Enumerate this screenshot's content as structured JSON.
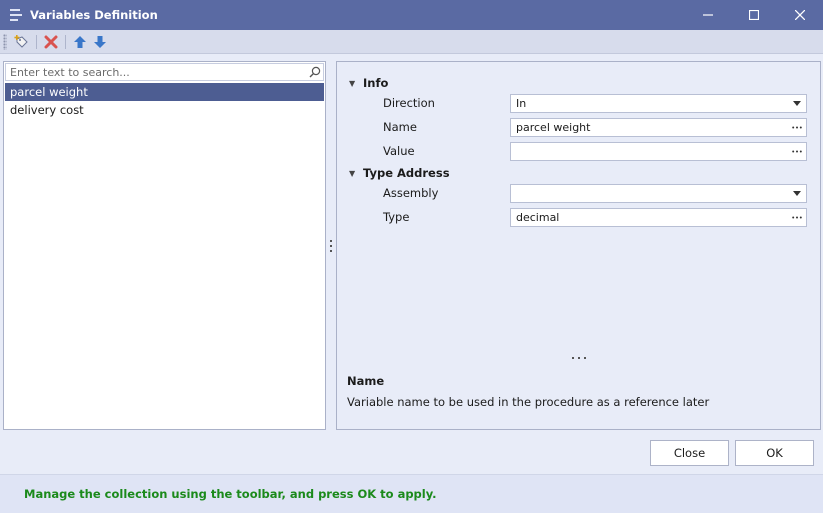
{
  "window": {
    "title": "Variables Definition",
    "buttons": [
      "minimize",
      "maximize",
      "close"
    ]
  },
  "toolbar": {
    "icons": [
      "add-variable-icon",
      "delete-icon",
      "move-up-icon",
      "move-down-icon"
    ],
    "colors": {
      "add": "#2d6cc4",
      "delete": "#d9534f",
      "arrows": "#3a77c9"
    }
  },
  "search": {
    "placeholder": "Enter text to search..."
  },
  "variables": {
    "items": [
      {
        "label": "parcel weight",
        "selected": true
      },
      {
        "label": "delivery cost",
        "selected": false
      }
    ]
  },
  "properties": {
    "categories": [
      {
        "label": "Info",
        "rows": [
          {
            "label": "Direction",
            "value": "In",
            "editor": "dropdown"
          },
          {
            "label": "Name",
            "value": "parcel weight",
            "editor": "ellipsis"
          },
          {
            "label": "Value",
            "value": "",
            "editor": "ellipsis"
          }
        ]
      },
      {
        "label": "Type Address",
        "rows": [
          {
            "label": "Assembly",
            "value": "",
            "editor": "dropdown"
          },
          {
            "label": "Type",
            "value": "decimal",
            "editor": "ellipsis"
          }
        ]
      }
    ]
  },
  "description": {
    "title": "Name",
    "text": "Variable name to be used in the procedure as a reference later"
  },
  "buttons": {
    "close": "Close",
    "ok": "OK"
  },
  "status": {
    "message": "Manage the collection using the toolbar, and press OK to apply.",
    "color": "#1b8a1b"
  },
  "theme": {
    "titlebar": "#5a6aa3",
    "selection": "#4d5d92",
    "background": "#e8ecf8"
  }
}
